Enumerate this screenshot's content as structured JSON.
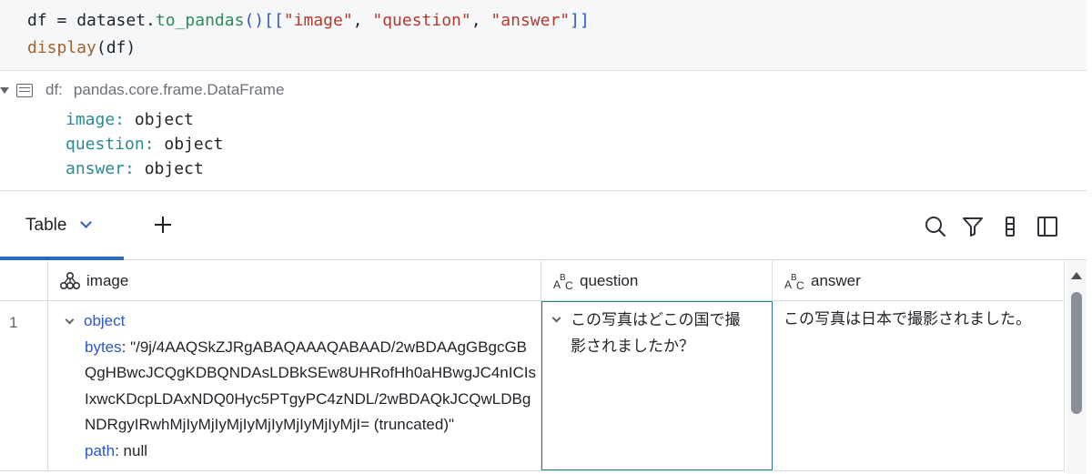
{
  "code": {
    "line1": {
      "var": "df",
      "eq": " = ",
      "obj": "dataset.",
      "method": "to_pandas",
      "open": "()[[",
      "s1": "\"image\"",
      "c1": ", ",
      "s2": "\"question\"",
      "c2": ", ",
      "s3": "\"answer\"",
      "close": "]]"
    },
    "line2": {
      "fn": "display",
      "args": "(df)"
    }
  },
  "schema": {
    "name": "df:",
    "type": "pandas.core.frame.DataFrame",
    "fields": [
      {
        "key": "image:",
        "value": "object"
      },
      {
        "key": "question:",
        "value": "object"
      },
      {
        "key": "answer:",
        "value": "object"
      }
    ]
  },
  "toolbar": {
    "tab_label": "Table",
    "icons": [
      "search-icon",
      "filter-icon",
      "column-settings-icon",
      "sidebar-toggle-icon"
    ]
  },
  "table": {
    "columns": [
      {
        "label": "image",
        "icon": "struct-icon"
      },
      {
        "label": "question",
        "icon": "string-type-icon"
      },
      {
        "label": "answer",
        "icon": "string-type-icon"
      }
    ],
    "rows": [
      {
        "index": "1",
        "image": {
          "toggle_label": "object",
          "bytes_key": "bytes",
          "bytes_lines": [
            ": \"/9j/4AAQSkZJRgABAQAAAQABAAD/2wBDAAgGBgcGB",
            "QgHBwcJCQgKDBQNDAsLDBkSEw8UHRofHh0aHBwgJC4nICIs",
            "IxwcKDcpLDAxNDQ0Hyc5PTgyPC4zNDL/2wBDAQkJCQwLDBg",
            "NDRgyIRwhMjIyMjIyMjIyMjIyMjIyMjIyMjI= (truncated)\""
          ],
          "path_key": "path",
          "path_value": ": null"
        },
        "question_lines": [
          "この写真はどこの国で撮",
          "影されましたか？"
        ],
        "answer": "この写真は日本で撮影されました。"
      }
    ]
  }
}
